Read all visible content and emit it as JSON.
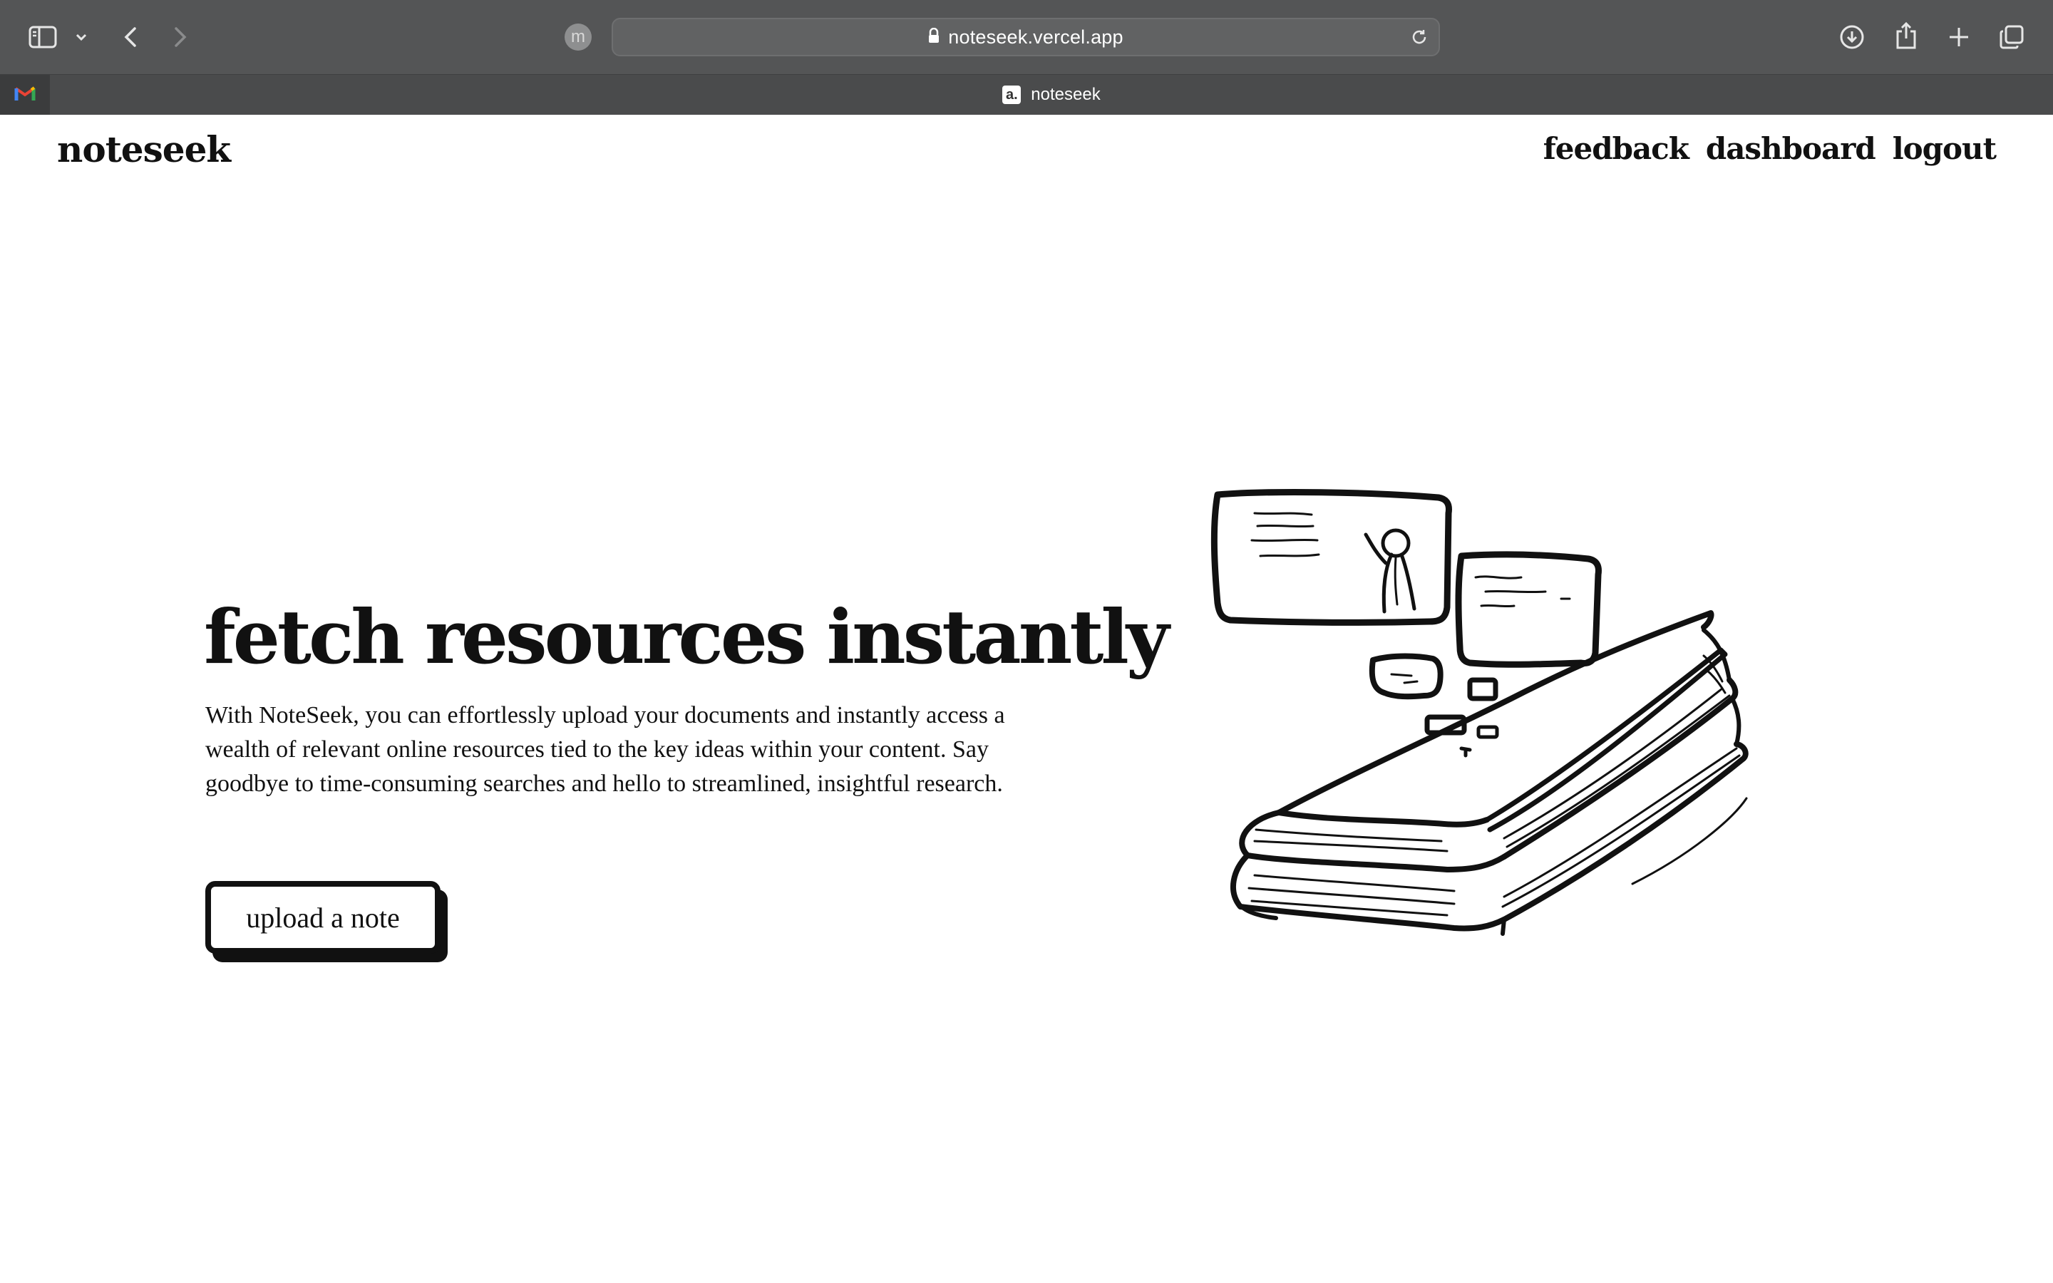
{
  "browser": {
    "url": "noteseek.vercel.app",
    "profile_initial": "m",
    "active_tab_title": "noteseek",
    "favicon_text": "a.",
    "pinned_tab": "gmail-icon"
  },
  "header": {
    "logo": "noteseek",
    "nav": [
      "feedback",
      "dashboard",
      "logout"
    ]
  },
  "hero": {
    "title": "fetch resources instantly",
    "description": "With NoteSeek, you can effortlessly upload your documents and instantly access a wealth of relevant online resources tied to the key ideas within your content. Say goodbye to time-consuming searches and hello to streamlined, insightful research.",
    "cta_label": "upload a note",
    "illustration": "books-with-thought-bubbles"
  },
  "colors": {
    "chrome_toolbar": "#545556",
    "chrome_tabbar": "#4a4b4c",
    "page_background": "#ffffff",
    "ink": "#111111"
  }
}
